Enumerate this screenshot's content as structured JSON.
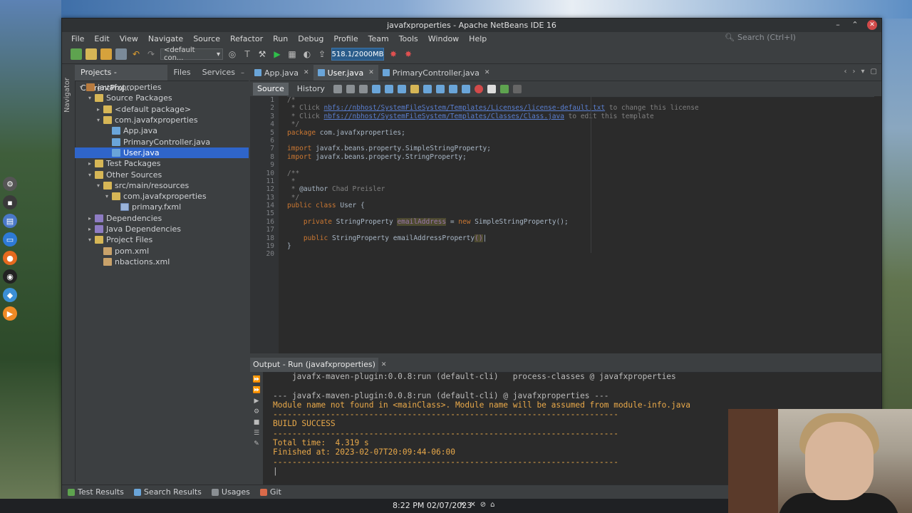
{
  "window": {
    "title": "javafxproperties - Apache NetBeans IDE 16"
  },
  "menu": [
    "File",
    "Edit",
    "View",
    "Navigate",
    "Source",
    "Refactor",
    "Run",
    "Debug",
    "Profile",
    "Team",
    "Tools",
    "Window",
    "Help"
  ],
  "search": {
    "placeholder": "Search (Ctrl+I)"
  },
  "toolbar": {
    "config": "<default con...",
    "memory": "518.1/2000MB"
  },
  "projects_panel": {
    "tabs": [
      "Projects - CurrentProj...",
      "Files",
      "Services"
    ],
    "navigator_label": "Navigator",
    "tree": [
      {
        "label": "javafxproperties",
        "level": 0,
        "icon": "project",
        "toggle": "▾"
      },
      {
        "label": "Source Packages",
        "level": 1,
        "icon": "folder",
        "toggle": "▾"
      },
      {
        "label": "<default package>",
        "level": 2,
        "icon": "folder",
        "toggle": "▸"
      },
      {
        "label": "com.javafxproperties",
        "level": 2,
        "icon": "folder",
        "toggle": "▾"
      },
      {
        "label": "App.java",
        "level": 3,
        "icon": "java",
        "toggle": ""
      },
      {
        "label": "PrimaryController.java",
        "level": 3,
        "icon": "java",
        "toggle": ""
      },
      {
        "label": "User.java",
        "level": 3,
        "icon": "java",
        "toggle": "",
        "selected": true
      },
      {
        "label": "Test Packages",
        "level": 1,
        "icon": "folder",
        "toggle": "▸"
      },
      {
        "label": "Other Sources",
        "level": 1,
        "icon": "folder",
        "toggle": "▾"
      },
      {
        "label": "src/main/resources",
        "level": 2,
        "icon": "folder",
        "toggle": "▾"
      },
      {
        "label": "com.javafxproperties",
        "level": 3,
        "icon": "folder",
        "toggle": "▾"
      },
      {
        "label": "primary.fxml",
        "level": 4,
        "icon": "fxml",
        "toggle": ""
      },
      {
        "label": "Dependencies",
        "level": 1,
        "icon": "lib",
        "toggle": "▸"
      },
      {
        "label": "Java Dependencies",
        "level": 1,
        "icon": "lib",
        "toggle": "▸"
      },
      {
        "label": "Project Files",
        "level": 1,
        "icon": "folder",
        "toggle": "▾"
      },
      {
        "label": "pom.xml",
        "level": 2,
        "icon": "xml",
        "toggle": ""
      },
      {
        "label": "nbactions.xml",
        "level": 2,
        "icon": "xml",
        "toggle": ""
      }
    ]
  },
  "editor": {
    "tabs": [
      {
        "label": "App.java",
        "active": false
      },
      {
        "label": "User.java",
        "active": true
      },
      {
        "label": "PrimaryController.java",
        "active": false
      }
    ],
    "source_tab": "Source",
    "history_tab": "History",
    "lines": [
      {
        "n": "1",
        "segs": [
          [
            "cm",
            "/*"
          ]
        ]
      },
      {
        "n": "2",
        "segs": [
          [
            "cm",
            " * Click "
          ],
          [
            "lk",
            "nbfs://nbhost/SystemFileSystem/Templates/Licenses/license-default.txt"
          ],
          [
            "cm",
            " to change this license"
          ]
        ]
      },
      {
        "n": "3",
        "segs": [
          [
            "cm",
            " * Click "
          ],
          [
            "lk",
            "nbfs://nbhost/SystemFileSystem/Templates/Classes/Class.java"
          ],
          [
            "cm",
            " to edit this template"
          ]
        ]
      },
      {
        "n": "4",
        "segs": [
          [
            "cm",
            " */"
          ]
        ]
      },
      {
        "n": "5",
        "segs": [
          [
            "kw",
            "package "
          ],
          [
            "",
            "com.javafxproperties;"
          ]
        ]
      },
      {
        "n": "6",
        "segs": []
      },
      {
        "n": "7",
        "segs": [
          [
            "kw",
            "import "
          ],
          [
            "",
            "javafx.beans.property.SimpleStringProperty;"
          ]
        ]
      },
      {
        "n": "8",
        "segs": [
          [
            "kw",
            "import "
          ],
          [
            "",
            "javafx.beans.property.StringProperty;"
          ]
        ]
      },
      {
        "n": "9",
        "segs": []
      },
      {
        "n": "10",
        "segs": [
          [
            "cm",
            "/**"
          ]
        ]
      },
      {
        "n": "11",
        "segs": [
          [
            "cm",
            " *"
          ]
        ]
      },
      {
        "n": "12",
        "segs": [
          [
            "cm",
            " * "
          ],
          [
            "",
            "@author"
          ],
          [
            "cm",
            " Chad Preisler"
          ]
        ]
      },
      {
        "n": "13",
        "segs": [
          [
            "cm",
            " */"
          ]
        ]
      },
      {
        "n": "14",
        "segs": [
          [
            "kw",
            "public class "
          ],
          [
            "",
            "User {"
          ]
        ]
      },
      {
        "n": "15",
        "segs": []
      },
      {
        "n": "16",
        "segs": [
          [
            "",
            "    "
          ],
          [
            "kw",
            "private "
          ],
          [
            "",
            "StringProperty "
          ],
          [
            "hl",
            "emailAddress"
          ],
          [
            "",
            " = "
          ],
          [
            "kw",
            "new "
          ],
          [
            "",
            "SimpleStringProperty();"
          ]
        ]
      },
      {
        "n": "17",
        "segs": []
      },
      {
        "n": "18",
        "segs": [
          [
            "",
            "    "
          ],
          [
            "kw",
            "public "
          ],
          [
            "",
            "StringProperty emailAddressProperty"
          ],
          [
            "hl",
            "()"
          ],
          [
            "",
            "|"
          ]
        ]
      },
      {
        "n": "19",
        "segs": [
          [
            "",
            "}"
          ]
        ]
      },
      {
        "n": "20",
        "segs": []
      }
    ]
  },
  "output": {
    "tab": "Output - Run (javafxproperties)",
    "lines": [
      {
        "text": "    javafx-maven-plugin:0.0.8:run (default-cli)   process-classes @ javafxproperties",
        "cls": ""
      },
      {
        "text": "",
        "cls": ""
      },
      {
        "text": "--- javafx-maven-plugin:0.0.8:run (default-cli) @ javafxproperties ---",
        "cls": ""
      },
      {
        "text": "Module name not found in <mainClass>. Module name will be assumed from module-info.java",
        "cls": "warn"
      },
      {
        "text": "------------------------------------------------------------------------",
        "cls": "warn"
      },
      {
        "text": "BUILD SUCCESS",
        "cls": "warn"
      },
      {
        "text": "------------------------------------------------------------------------",
        "cls": "warn"
      },
      {
        "text": "Total time:  4.319 s",
        "cls": "warn"
      },
      {
        "text": "Finished at: 2023-02-07T20:09:44-06:00",
        "cls": "warn"
      },
      {
        "text": "------------------------------------------------------------------------",
        "cls": "warn"
      },
      {
        "text": "|",
        "cls": ""
      }
    ]
  },
  "bottom_bar": [
    "Test Results",
    "Search Results",
    "Usages",
    "Git"
  ],
  "taskbar": {
    "time": "8:22 PM 02/07/2023"
  }
}
